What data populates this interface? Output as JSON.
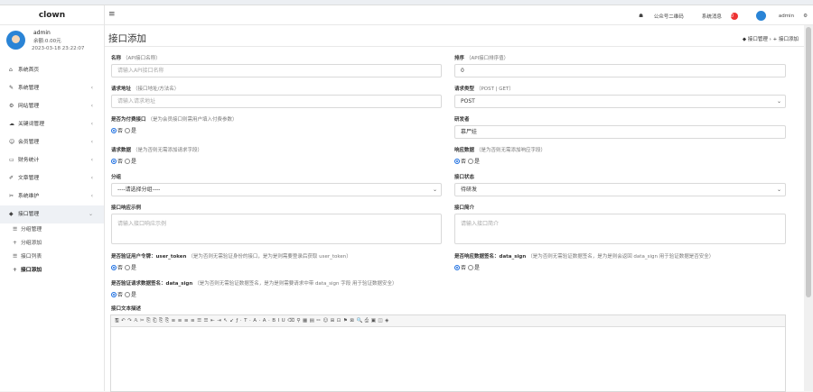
{
  "sidebar": {
    "brand": "clown",
    "profile": {
      "name": "admin",
      "balance": "余额:0.00元",
      "time": "2023-03-18 23:22:07"
    },
    "menu": [
      {
        "icon": "home-icon",
        "glyph": "⌂",
        "label": "系统首页",
        "arrow": ""
      },
      {
        "icon": "wrench-icon",
        "glyph": "✎",
        "label": "系统管理",
        "arrow": "‹"
      },
      {
        "icon": "gear-icon",
        "glyph": "⚙",
        "label": "网站管理",
        "arrow": "‹"
      },
      {
        "icon": "cloud-icon",
        "glyph": "☁",
        "label": "关键词管理",
        "arrow": "‹"
      },
      {
        "icon": "users-icon",
        "glyph": "☺",
        "label": "会员管理",
        "arrow": "‹"
      },
      {
        "icon": "card-icon",
        "glyph": "▭",
        "label": "财务统计",
        "arrow": "‹"
      },
      {
        "icon": "pen-icon",
        "glyph": "✐",
        "label": "文章管理",
        "arrow": "‹"
      },
      {
        "icon": "tools-icon",
        "glyph": "✂",
        "label": "系统维护",
        "arrow": "‹"
      },
      {
        "icon": "api-icon",
        "glyph": "◆",
        "label": "接口管理",
        "arrow": "⌄"
      }
    ],
    "submenu": [
      {
        "glyph": "☰",
        "label": "分组管理"
      },
      {
        "glyph": "+",
        "label": "分组添加"
      },
      {
        "glyph": "☰",
        "label": "接口列表"
      },
      {
        "glyph": "+",
        "label": "接口添加"
      }
    ]
  },
  "header": {
    "qrcode": "公众号二维码",
    "messages": "系统消息",
    "message_count": "0",
    "user": "admin"
  },
  "page": {
    "title": "接口添加",
    "crumb_parent": "接口管理",
    "crumb_current": "接口添加"
  },
  "form": {
    "name": {
      "label": "名称",
      "hint": "（API接口名称）",
      "placeholder": "请输入API接口名称"
    },
    "sort": {
      "label": "排序",
      "hint": "（API接口排序值）",
      "value": "0"
    },
    "url": {
      "label": "请求地址",
      "hint": "（接口地址/方法名）",
      "placeholder": "请输入请求地址"
    },
    "method": {
      "label": "请求类型",
      "hint": "（POST | GET）",
      "value": "POST"
    },
    "pay": {
      "label": "是否为付费接口",
      "hint": "（是为会员接口则需用户填入付费参数）",
      "no": "否",
      "yes": "是"
    },
    "developer": {
      "label": "研发者",
      "value": "慕尸娃"
    },
    "req_data": {
      "label": "请求数据",
      "hint": "（是为否则无需添加请求字段）",
      "no": "否",
      "yes": "是"
    },
    "resp_data": {
      "label": "响应数据",
      "hint": "（是为否则无需添加响应字段）",
      "no": "否",
      "yes": "是"
    },
    "group": {
      "label": "分组",
      "value": "----请选择分组----"
    },
    "status": {
      "label": "接口状态",
      "value": "待研发"
    },
    "example": {
      "label": "接口响应示例",
      "placeholder": "请输入接口响应示例"
    },
    "intro": {
      "label": "接口简介",
      "placeholder": "请输入接口简介"
    },
    "token": {
      "label": "是否验证用户令牌：user_token",
      "hint": "（是为否则无需验证身份的接口，是为是则需要登录后获取 user_token）",
      "no": "否",
      "yes": "是"
    },
    "resp_sign": {
      "label": "是否响应数据签名：data_sign",
      "hint": "（是为否则无需验证数据签名，是为是则会返回 data_sign 用于验证数据是否安全）",
      "no": "否",
      "yes": "是"
    },
    "req_sign": {
      "label": "是否验证请求数据签名：data_sign",
      "hint": "（是为否则无需验证数据签名，是为是则需要请求中带 data_sign 字段 用于验证数据安全）",
      "no": "否",
      "yes": "是"
    },
    "doc": {
      "label": "接口文本描述",
      "toolbar": "🖫↶↷𝔸✂⎘⎗⎘⎘≡≡≡≡☰☰⇤⇥↖↙ƒ·T·A·A·BIU⌫⚲▦▤✏☺⊞⊡⚑⊠🔍⎙▣◫◈"
    }
  }
}
